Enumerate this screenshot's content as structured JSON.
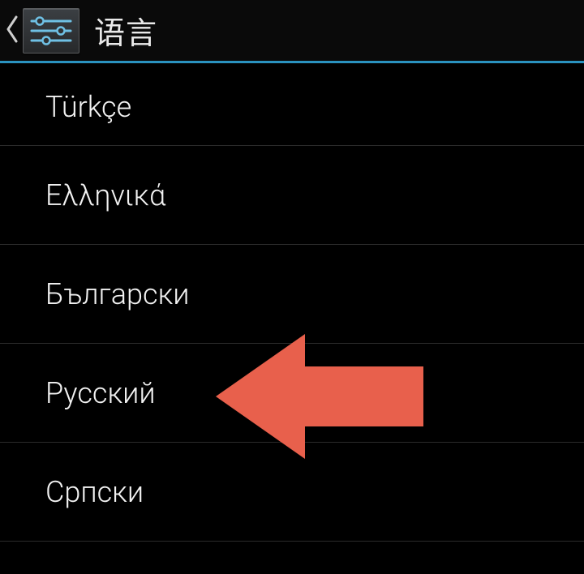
{
  "header": {
    "title": "语言",
    "icon_name": "settings-sliders-icon",
    "back_icon_name": "chevron-left-icon"
  },
  "languages": [
    {
      "label": "Türkçe"
    },
    {
      "label": "Ελληνικά"
    },
    {
      "label": "Български"
    },
    {
      "label": "Русский"
    },
    {
      "label": "Српски"
    }
  ],
  "annotation": {
    "arrow_color": "#e8604c",
    "points_to_index": 3
  }
}
